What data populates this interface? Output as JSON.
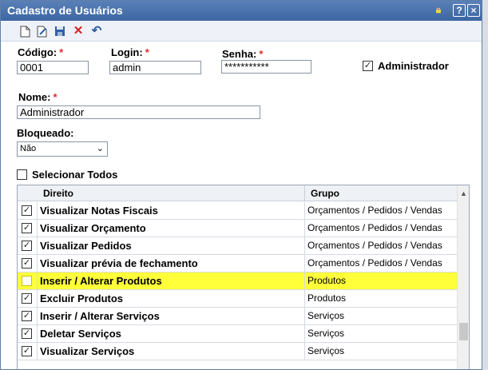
{
  "window": {
    "title": "Cadastro de Usuários"
  },
  "title_icons": [
    "lock-icon",
    "help-icon",
    "close-icon"
  ],
  "toolbar": {
    "icons": [
      "new-document-icon",
      "edit-icon",
      "save-icon",
      "delete-icon",
      "undo-icon"
    ]
  },
  "form": {
    "codigo_label": "Código:",
    "codigo_value": "0001",
    "login_label": "Login:",
    "login_value": "admin",
    "senha_label": "Senha:",
    "senha_value": "***********",
    "admin_label": "Administrador",
    "admin_checked": true,
    "nome_label": "Nome:",
    "nome_value": "Administrador",
    "bloqueado_label": "Bloqueado:",
    "bloqueado_value": "Não",
    "required_mark": "*",
    "select_all_label": "Selecionar Todos",
    "select_all_checked": false
  },
  "grid": {
    "headers": {
      "direito": "Direito",
      "grupo": "Grupo"
    },
    "rows": [
      {
        "name": "Visualizar Notas Fiscais",
        "group": "Orçamentos / Pedidos / Vendas",
        "checked": true
      },
      {
        "name": "Visualizar Orçamento",
        "group": "Orçamentos / Pedidos / Vendas",
        "checked": true
      },
      {
        "name": "Visualizar Pedidos",
        "group": "Orçamentos / Pedidos / Vendas",
        "checked": true
      },
      {
        "name": "Visualizar prévia de fechamento",
        "group": "Orçamentos / Pedidos / Vendas",
        "checked": true
      },
      {
        "name": "Inserir / Alterar Produtos",
        "group": "Produtos",
        "checked": false,
        "highlighted": true
      },
      {
        "name": "Excluir Produtos",
        "group": "Produtos",
        "checked": true
      },
      {
        "name": "Inserir / Alterar Serviços",
        "group": "Serviços",
        "checked": true
      },
      {
        "name": "Deletar Serviços",
        "group": "Serviços",
        "checked": true
      },
      {
        "name": "Visualizar Serviços",
        "group": "Serviços",
        "checked": true
      }
    ]
  },
  "colors": {
    "title_bar": "#4a72ad",
    "highlight": "#ffff3a",
    "required": "#e12b2b"
  }
}
